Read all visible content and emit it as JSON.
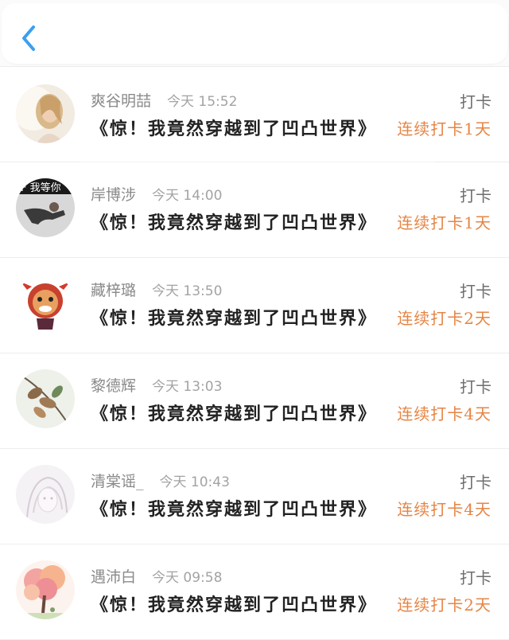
{
  "header": {
    "back_icon": "chevron-left-icon",
    "accent_color": "#3a9ff0"
  },
  "feed": {
    "items": [
      {
        "name": "爽谷明喆",
        "time": "今天 15:52",
        "title": "《惊！我竟然穿越到了凹凸世界》",
        "tag": "打卡",
        "streak": "连续打卡1天",
        "avatar": "avatar-blonde-woman"
      },
      {
        "name": "岸博涉",
        "time": "今天 14:00",
        "title": "《惊！我竟然穿越到了凹凸世界》",
        "tag": "打卡",
        "streak": "连续打卡1天",
        "avatar": "avatar-dancer-text"
      },
      {
        "name": "藏梓璐",
        "time": "今天 13:50",
        "title": "《惊！我竟然穿越到了凹凸世界》",
        "tag": "打卡",
        "streak": "连续打卡2天",
        "avatar": "avatar-cartoon-bull"
      },
      {
        "name": "黎德辉",
        "time": "今天 13:03",
        "title": "《惊！我竟然穿越到了凹凸世界》",
        "tag": "打卡",
        "streak": "连续打卡4天",
        "avatar": "avatar-leaves"
      },
      {
        "name": "清棠谣_",
        "time": "今天 10:43",
        "title": "《惊！我竟然穿越到了凹凸世界》",
        "tag": "打卡",
        "streak": "连续打卡4天",
        "avatar": "avatar-sketch-girl"
      },
      {
        "name": "遇沛白",
        "time": "今天 09:58",
        "title": "《惊！我竟然穿越到了凹凸世界》",
        "tag": "打卡",
        "streak": "连续打卡2天",
        "avatar": "avatar-blossom-tree"
      }
    ],
    "avatar_text_1": "F 我等你",
    "streak_color": "#e58545"
  }
}
